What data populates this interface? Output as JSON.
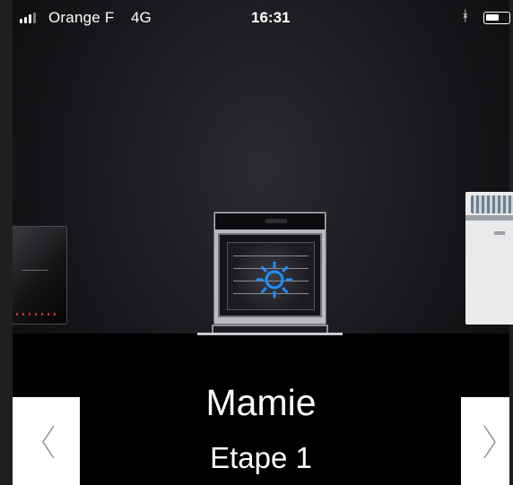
{
  "status_bar": {
    "carrier": "Orange F",
    "network": "4G",
    "time": "16:31",
    "bluetooth_icon": "bluetooth-icon",
    "battery_level": 0.6
  },
  "carousel": {
    "appliances": [
      {
        "name": "cooktop",
        "icon": "induction-cooktop"
      },
      {
        "name": "oven",
        "icon": "oven",
        "selected": true
      },
      {
        "name": "dishwasher",
        "icon": "dishwasher"
      }
    ],
    "highlight_color": "#1e90ff"
  },
  "main": {
    "title": "Mamie",
    "subtitle": "Etape 1"
  },
  "nav": {
    "prev_icon": "chevron-left-icon",
    "next_icon": "chevron-right-icon"
  }
}
